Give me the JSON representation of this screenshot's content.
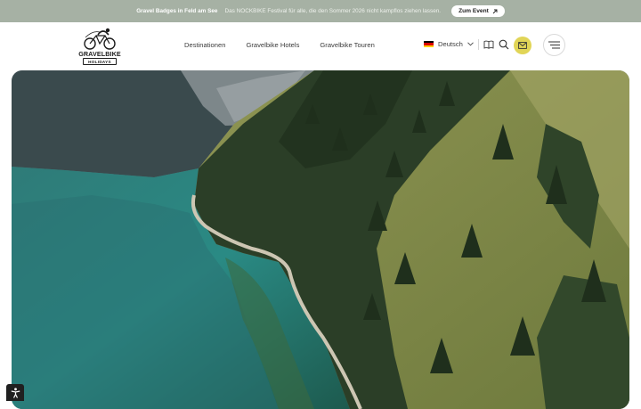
{
  "announcement": {
    "headline": "Gravel Badges in Feld am See",
    "text": "Das NOCKBIKE Festival für alle, die den Sommer 2026 nicht kampflos ziehen lassen.",
    "button_label": "Zum Event",
    "button_icon": "arrow-up-right-icon"
  },
  "logo": {
    "brand": "GRAVELBIKE",
    "sub": "HOLIDAYS"
  },
  "nav": {
    "items": [
      {
        "label": "Destinationen"
      },
      {
        "label": "Gravelbike Hotels"
      },
      {
        "label": "Gravelbike Touren"
      }
    ]
  },
  "language": {
    "selected": "Deutsch",
    "flag": [
      "#000000",
      "#dd0000",
      "#ffce00"
    ]
  },
  "actions": {
    "icons": [
      "book-map-icon",
      "search-icon",
      "mail-icon",
      "hamburger-menu-icon"
    ],
    "mail_bg": "#e1d557"
  },
  "hero": {
    "description_icon": "hero-landscape-image"
  },
  "accessibility": {
    "icon": "accessibility-icon"
  },
  "colors": {
    "announce_bg": "#a6b1a4",
    "accent": "#e1d557"
  }
}
